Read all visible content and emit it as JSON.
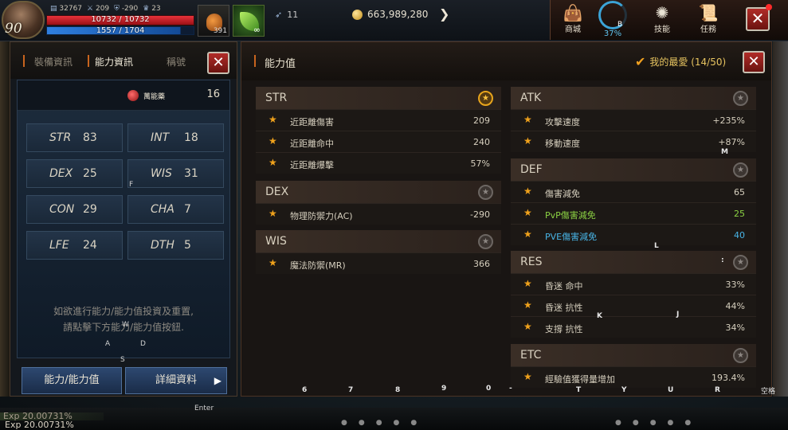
{
  "hud": {
    "level": "90",
    "combat_power": "32767",
    "sword_stat": "209",
    "shield_stat": "-290",
    "trophy_stat": "23",
    "hp_text": "10732 / 10732",
    "mp_text": "1557 / 1704",
    "mp_fraction": 0.914,
    "potion_count": "391",
    "leaf_count": "∞",
    "wing_count": "11",
    "gold": "663,989,280",
    "colors": {
      "hp": "#e8323a",
      "mp": "#2f7fe0",
      "accent": "#c8641e",
      "star": "#f0a21c"
    }
  },
  "menu": {
    "shop": "商城",
    "b_percent": "37%",
    "b_hotkey": "B",
    "skill": "技能",
    "quest": "任務",
    "close_glyph": "✕"
  },
  "left_panel": {
    "tabs": [
      "裝備資訊",
      "能力資訊",
      "稱號"
    ],
    "potion_label": "萬能藥",
    "points": "16",
    "stats": [
      {
        "name": "STR",
        "value": "83"
      },
      {
        "name": "INT",
        "value": "18"
      },
      {
        "name": "DEX",
        "value": "25"
      },
      {
        "name": "WIS",
        "value": "31"
      },
      {
        "name": "CON",
        "value": "29"
      },
      {
        "name": "CHA",
        "value": "7"
      },
      {
        "name": "LFE",
        "value": "24"
      },
      {
        "name": "DTH",
        "value": "5"
      }
    ],
    "notice_line1": "如欲進行能力/能力值投資及重置,",
    "notice_line2": "請點擊下方能力/能力值按鈕.",
    "button_ability": "能力/能力值",
    "button_details": "詳細資料"
  },
  "right_panel": {
    "title": "能力值",
    "favorites": "我的最愛 (14/50)",
    "sections": {
      "str": {
        "name": "STR",
        "rows": [
          {
            "label": "近距離傷害",
            "value": "209"
          },
          {
            "label": "近距離命中",
            "value": "240"
          },
          {
            "label": "近距離爆擊",
            "value": "57%"
          }
        ]
      },
      "dex": {
        "name": "DEX",
        "rows": [
          {
            "label": "物理防禦力(AC)",
            "value": "-290"
          }
        ]
      },
      "wis": {
        "name": "WIS",
        "rows": [
          {
            "label": "魔法防禦(MR)",
            "value": "366"
          }
        ]
      },
      "atk": {
        "name": "ATK",
        "rows": [
          {
            "label": "攻擊速度",
            "value": "+235%"
          },
          {
            "label": "移動速度",
            "value": "+87%"
          }
        ]
      },
      "def": {
        "name": "DEF",
        "rows": [
          {
            "label": "傷害減免",
            "value": "65"
          },
          {
            "label": "PvP傷害減免",
            "value": "25"
          },
          {
            "label": "PVE傷害減免",
            "value": "40"
          }
        ]
      },
      "res": {
        "name": "RES",
        "rows": [
          {
            "label": "昏迷 命中",
            "value": "33%"
          },
          {
            "label": "昏迷 抗性",
            "value": "44%"
          },
          {
            "label": "支撐 抗性",
            "value": "34%"
          }
        ]
      },
      "etc": {
        "name": "ETC",
        "rows": [
          {
            "label": "經驗值獲得量增加",
            "value": "193.4%"
          }
        ]
      }
    }
  },
  "hotkeys": {
    "f": "F",
    "m": "M",
    "l": "L",
    "colon": ":",
    "k": "K",
    "j": "J",
    "w": "W",
    "a": "A",
    "d": "D",
    "s": "S",
    "n6": "6",
    "n7": "7",
    "n8": "8",
    "n9": "9",
    "n0": "0",
    "dash": "-",
    "t": "T",
    "y": "Y",
    "u": "U",
    "r": "R",
    "enter": "Enter",
    "space": "空格"
  },
  "bottom": {
    "exp_shadow": "Exp 20.00731%",
    "exp": "Exp 20.00731%"
  }
}
